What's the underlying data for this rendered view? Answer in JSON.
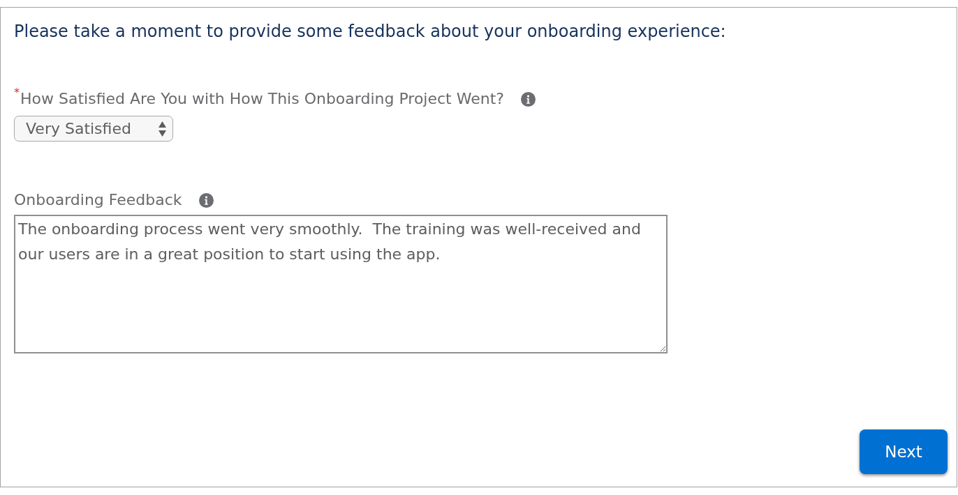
{
  "form": {
    "intro": "Please take a moment to provide some feedback about your onboarding experience:",
    "questions": [
      {
        "kind": "picklist",
        "required_mark": "*",
        "label": "How Satisfied Are You with How This Onboarding Project Went?",
        "value": "Very Satisfied"
      },
      {
        "kind": "long_text",
        "label": "Onboarding Feedback",
        "value": "The onboarding process went very smoothly.  The training was well-received and our users are in a great position to start using the app."
      }
    ]
  },
  "next_button": {
    "label": "Next"
  }
}
